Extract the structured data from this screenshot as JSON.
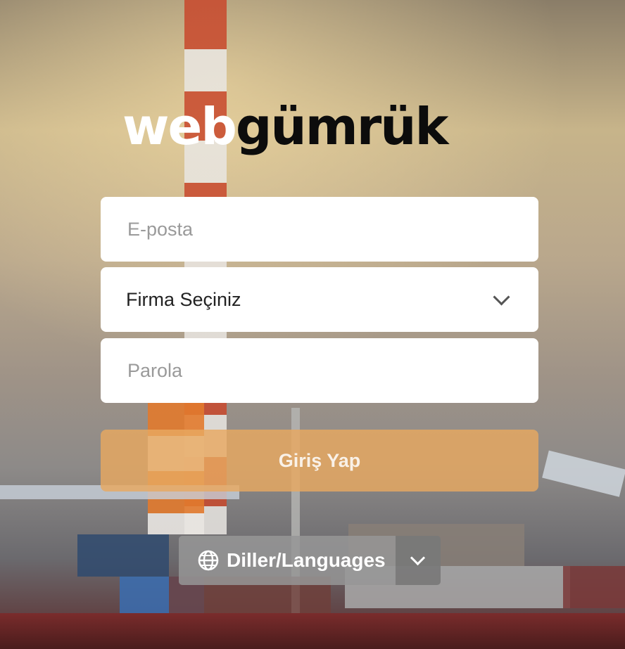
{
  "logo": {
    "part1": "web",
    "part2": "gümrük"
  },
  "form": {
    "email_placeholder": "E-posta",
    "company_select": "Firma Seçiniz",
    "password_placeholder": "Parola",
    "login_label": "Giriş Yap"
  },
  "language": {
    "label": "Diller/Languages"
  },
  "colors": {
    "login_button": "#e8a860",
    "logo_dark": "#0c0c0c",
    "logo_light": "#ffffff"
  }
}
